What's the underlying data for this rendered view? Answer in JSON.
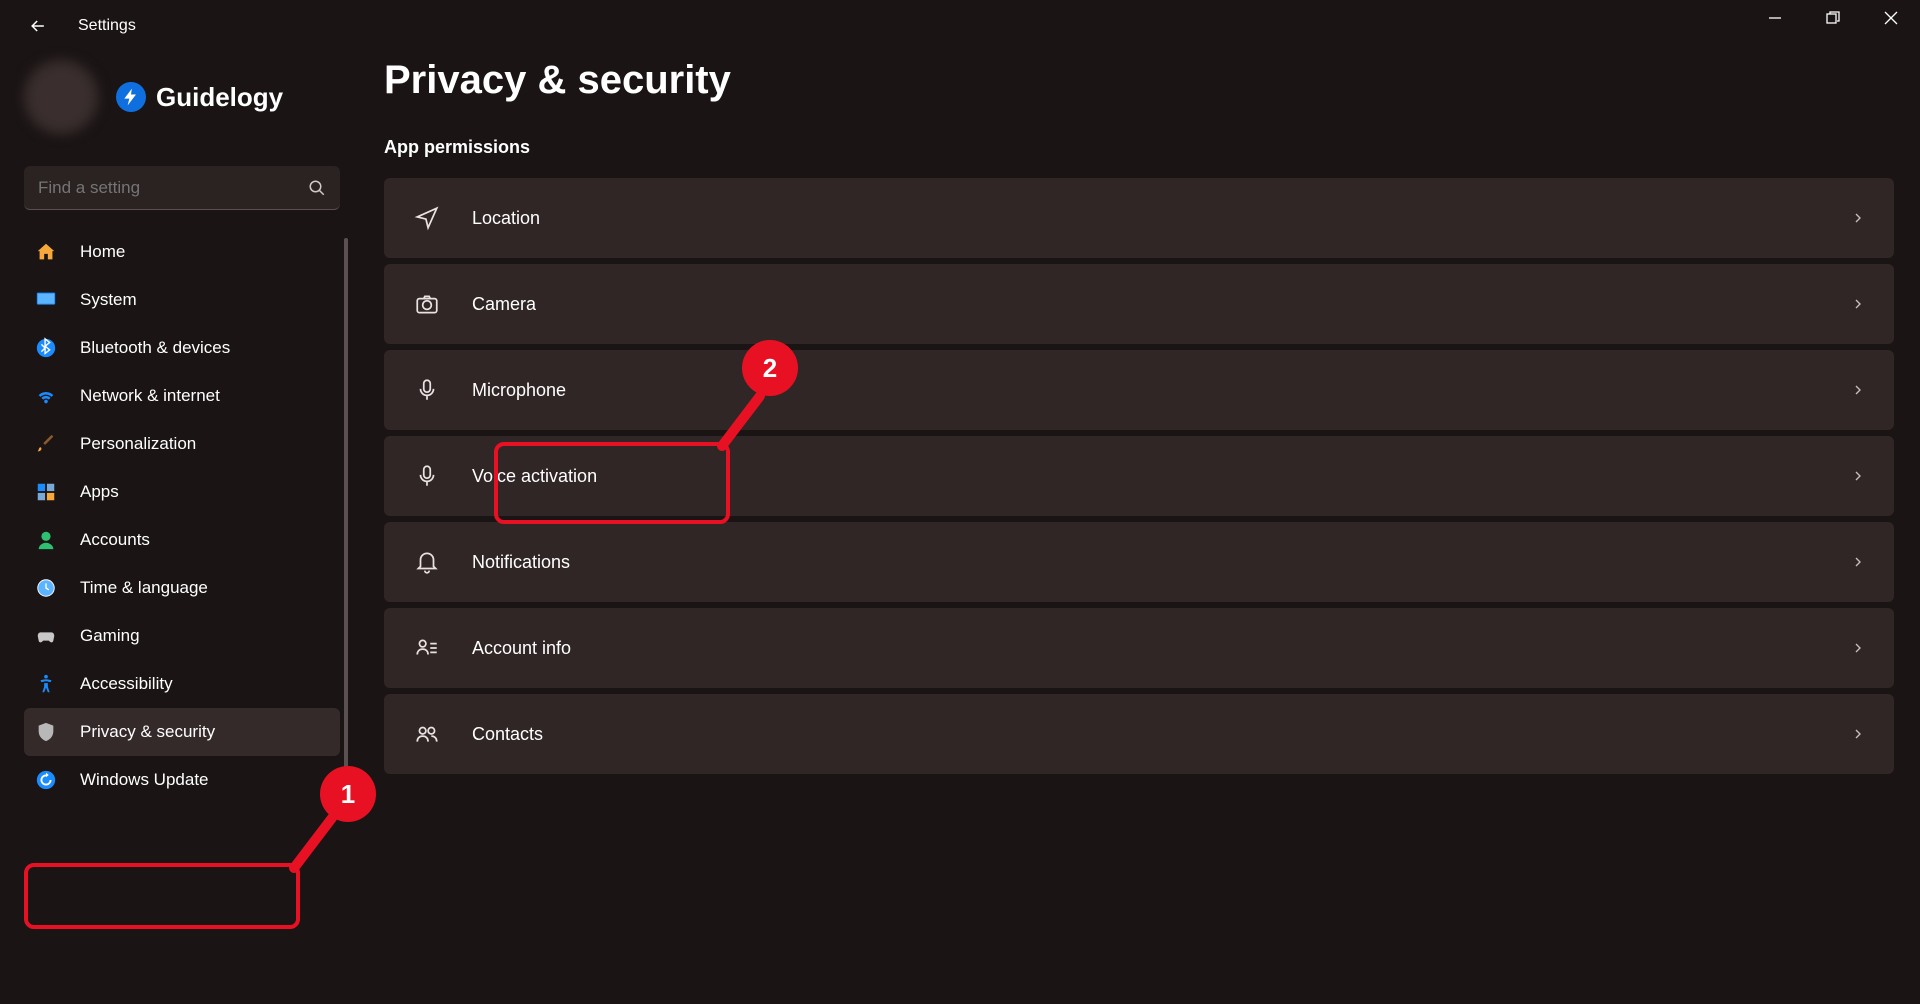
{
  "app_title": "Settings",
  "brand_text": "Guidelogy",
  "search": {
    "placeholder": "Find a setting"
  },
  "nav": {
    "items": [
      {
        "label": "Home"
      },
      {
        "label": "System"
      },
      {
        "label": "Bluetooth & devices"
      },
      {
        "label": "Network & internet"
      },
      {
        "label": "Personalization"
      },
      {
        "label": "Apps"
      },
      {
        "label": "Accounts"
      },
      {
        "label": "Time & language"
      },
      {
        "label": "Gaming"
      },
      {
        "label": "Accessibility"
      },
      {
        "label": "Privacy & security"
      },
      {
        "label": "Windows Update"
      }
    ]
  },
  "main": {
    "page_title": "Privacy & security",
    "section_label": "App permissions",
    "rows": [
      {
        "label": "Location"
      },
      {
        "label": "Camera"
      },
      {
        "label": "Microphone"
      },
      {
        "label": "Voice activation"
      },
      {
        "label": "Notifications"
      },
      {
        "label": "Account info"
      },
      {
        "label": "Contacts"
      }
    ]
  },
  "annotations": {
    "badge1": "1",
    "badge2": "2"
  }
}
